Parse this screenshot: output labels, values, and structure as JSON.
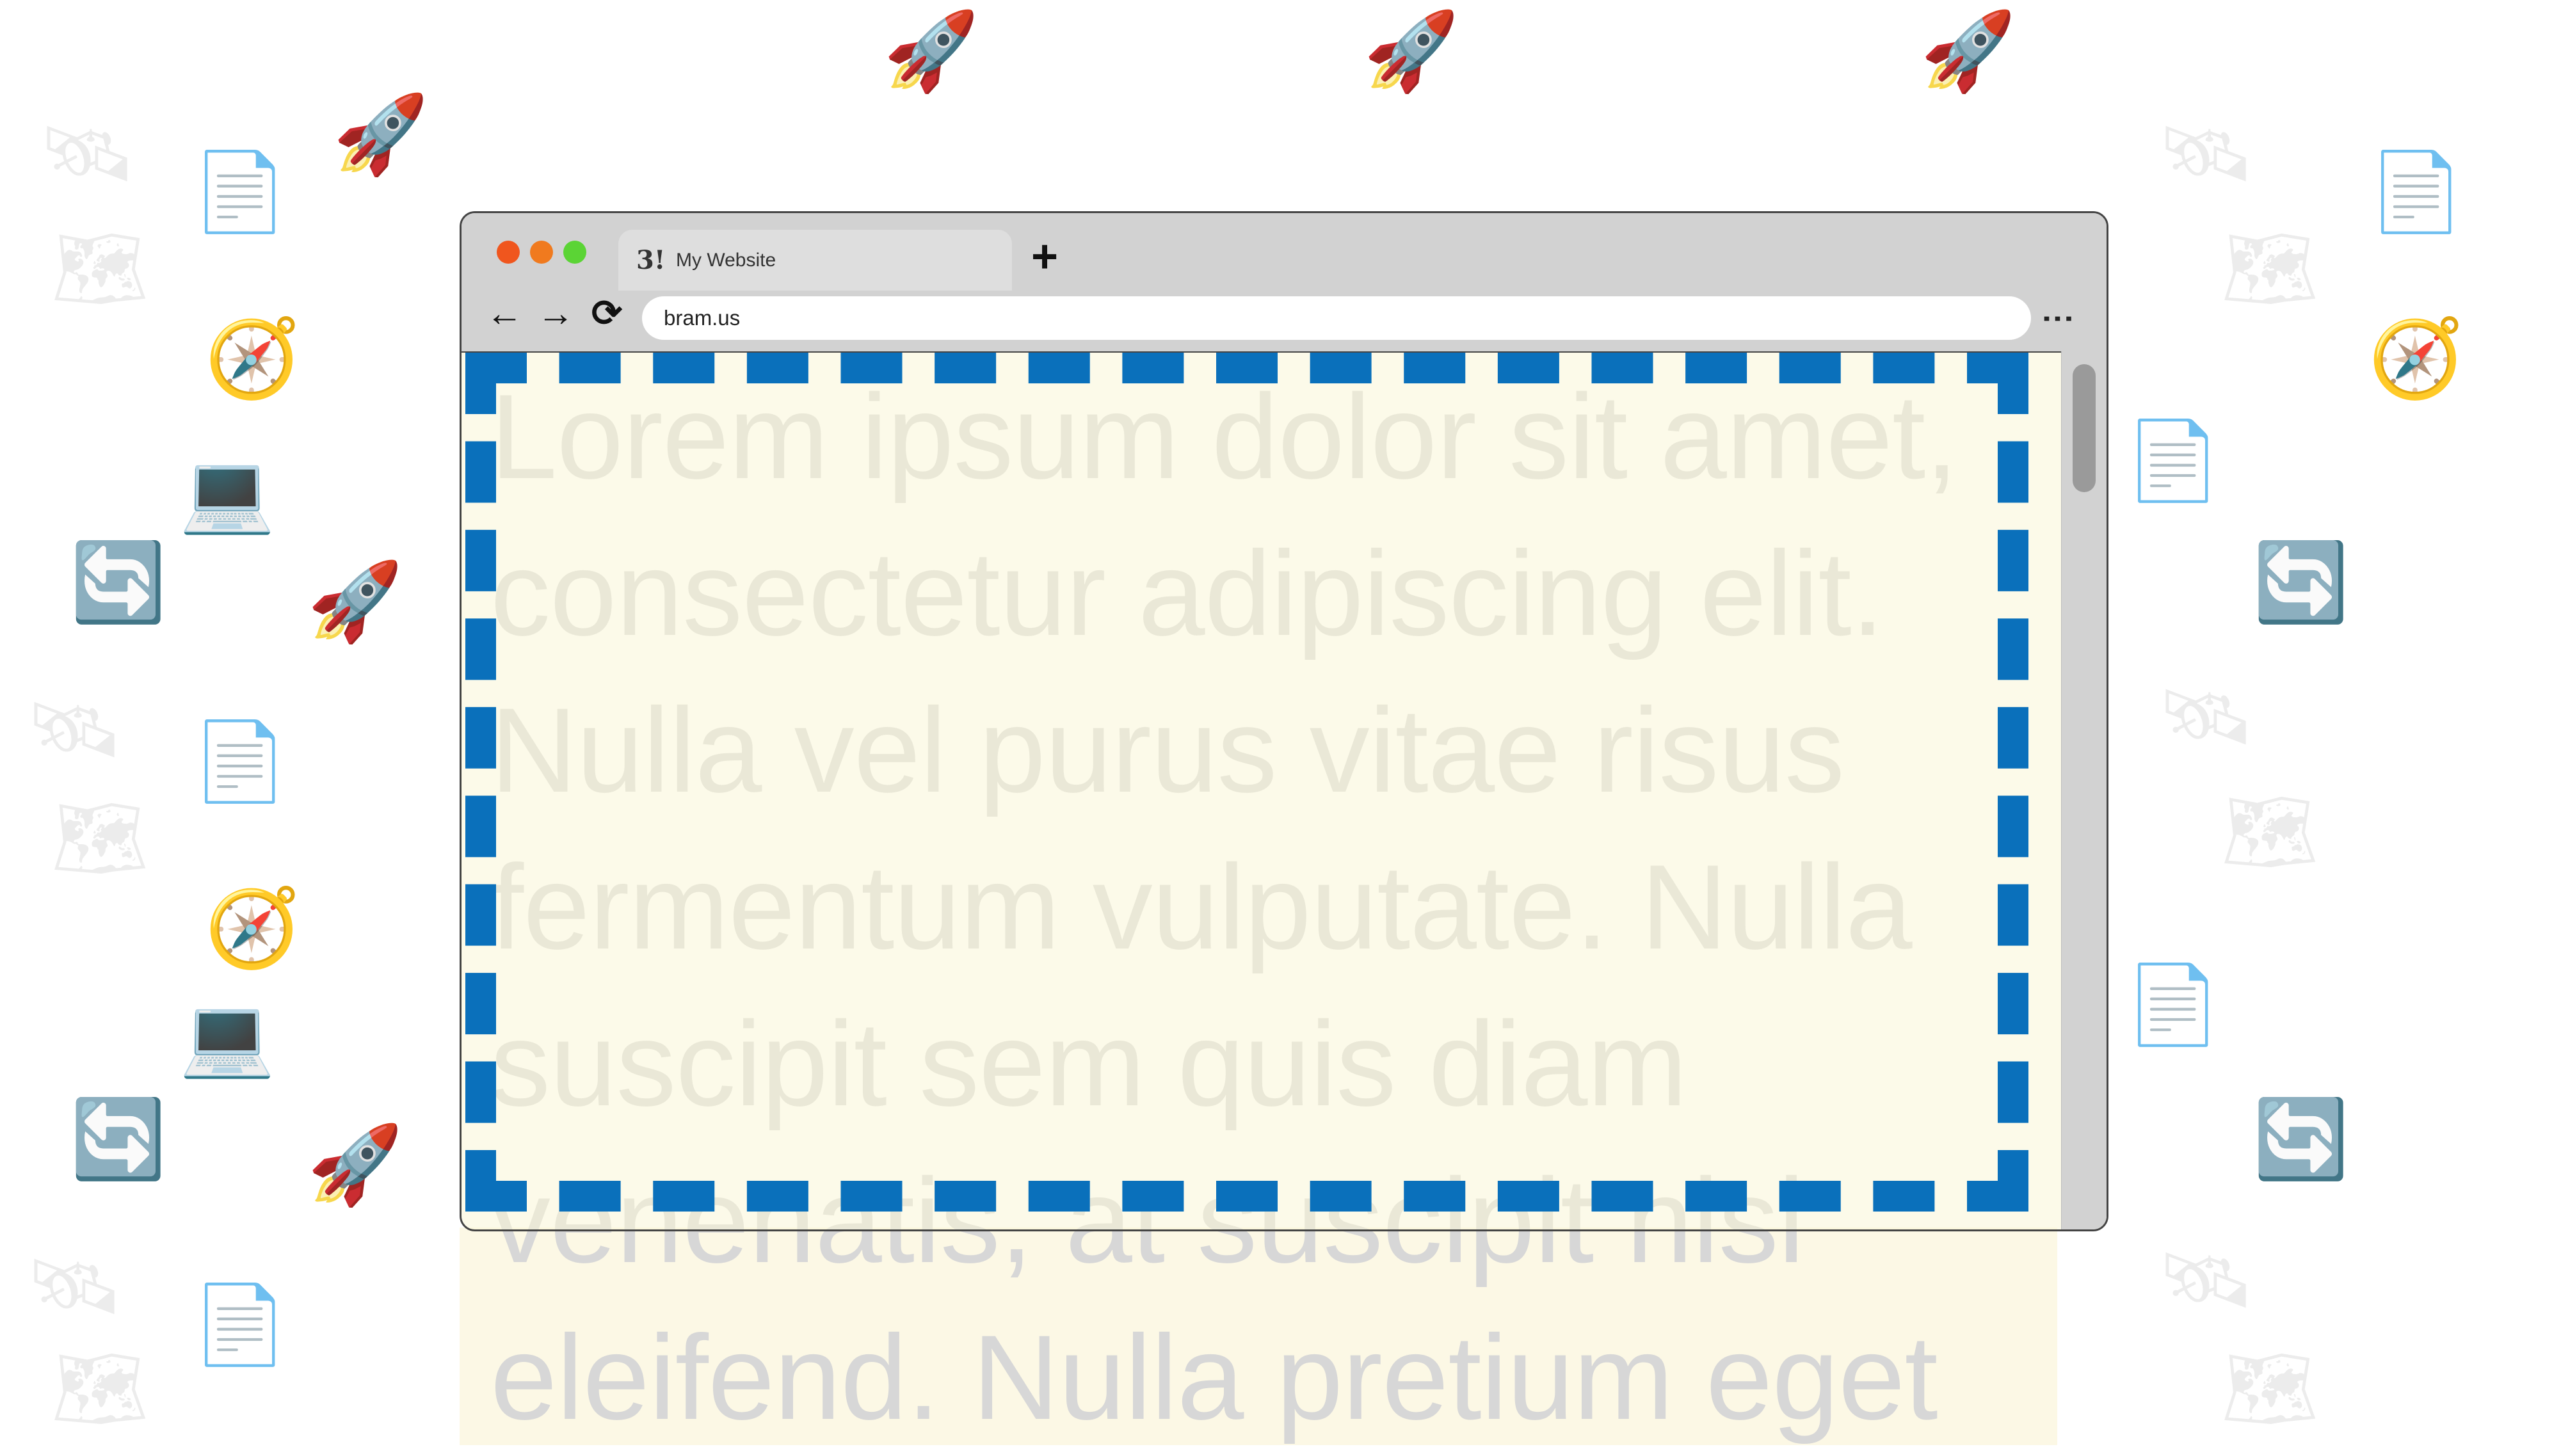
{
  "browser": {
    "tab_title": "My Website",
    "favicon_text": "3!",
    "new_tab_symbol": "+",
    "nav_back_symbol": "←",
    "nav_forward_symbol": "→",
    "nav_reload_symbol": "⟳",
    "address": "bram.us",
    "menu_symbol": "⋮",
    "traffic_lights": [
      "#f0561e",
      "#f07a1e",
      "#5bd435"
    ]
  },
  "content": {
    "text": "Lorem ipsum dolor sit amet, consectetur adipiscing elit. Nulla vel purus vitae risus fermentum vulputate. Nulla suscipit sem quis diam venenatis, at suscipit nisl eleifend. Nulla pretium eget"
  },
  "colors": {
    "outline": "#0a70bb",
    "page_bg": "#faf5d7",
    "text": "#d7d7d7"
  },
  "icons": {
    "background_doodles": [
      "rocket",
      "satellite",
      "map",
      "html-file",
      "globe-laptop",
      "refresh",
      "compass",
      "css-file"
    ]
  }
}
